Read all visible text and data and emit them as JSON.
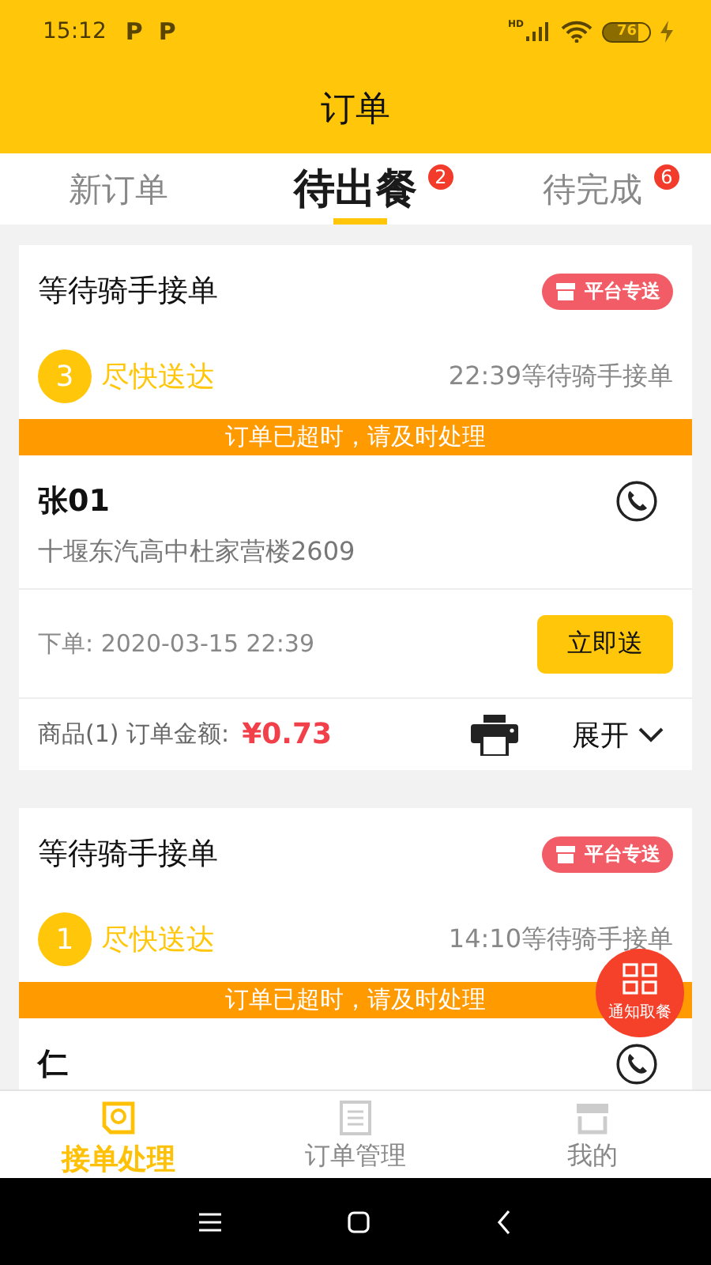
{
  "status_bar": {
    "time": "15:12",
    "notification_icons": [
      "P",
      "P"
    ],
    "network_label": "HD",
    "battery": "76"
  },
  "title": "订单",
  "tabs": [
    {
      "label": "新订单",
      "selected": false
    },
    {
      "label": "待出餐",
      "selected": true,
      "badge": "2"
    },
    {
      "label": "待完成",
      "selected": false,
      "badge": "6"
    }
  ],
  "orders": [
    {
      "status": "等待骑手接单",
      "tag": "平台专送",
      "number": "3",
      "delivery": "尽快送达",
      "rider_status": "22:39等待骑手接单",
      "alert": "订单已超时，请及时处理",
      "customer": "张01",
      "address": "十堰东汽高中杜家营楼2609",
      "order_time": "下单: 2020-03-15 22:39",
      "action": "立即送",
      "items": "商品(1) 订单金额:",
      "amount": "¥0.73",
      "expand": "展开"
    },
    {
      "status": "等待骑手接单",
      "tag": "平台专送",
      "number": "1",
      "delivery": "尽快送达",
      "rider_status": "14:10等待骑手接单",
      "alert": "订单已超时，请及时处理",
      "customer": "仁"
    }
  ],
  "floating_button": {
    "label": "通知取餐"
  },
  "bottom_nav": [
    {
      "label": "接单处理",
      "selected": true
    },
    {
      "label": "订单管理",
      "selected": false
    },
    {
      "label": "我的",
      "selected": false
    }
  ]
}
